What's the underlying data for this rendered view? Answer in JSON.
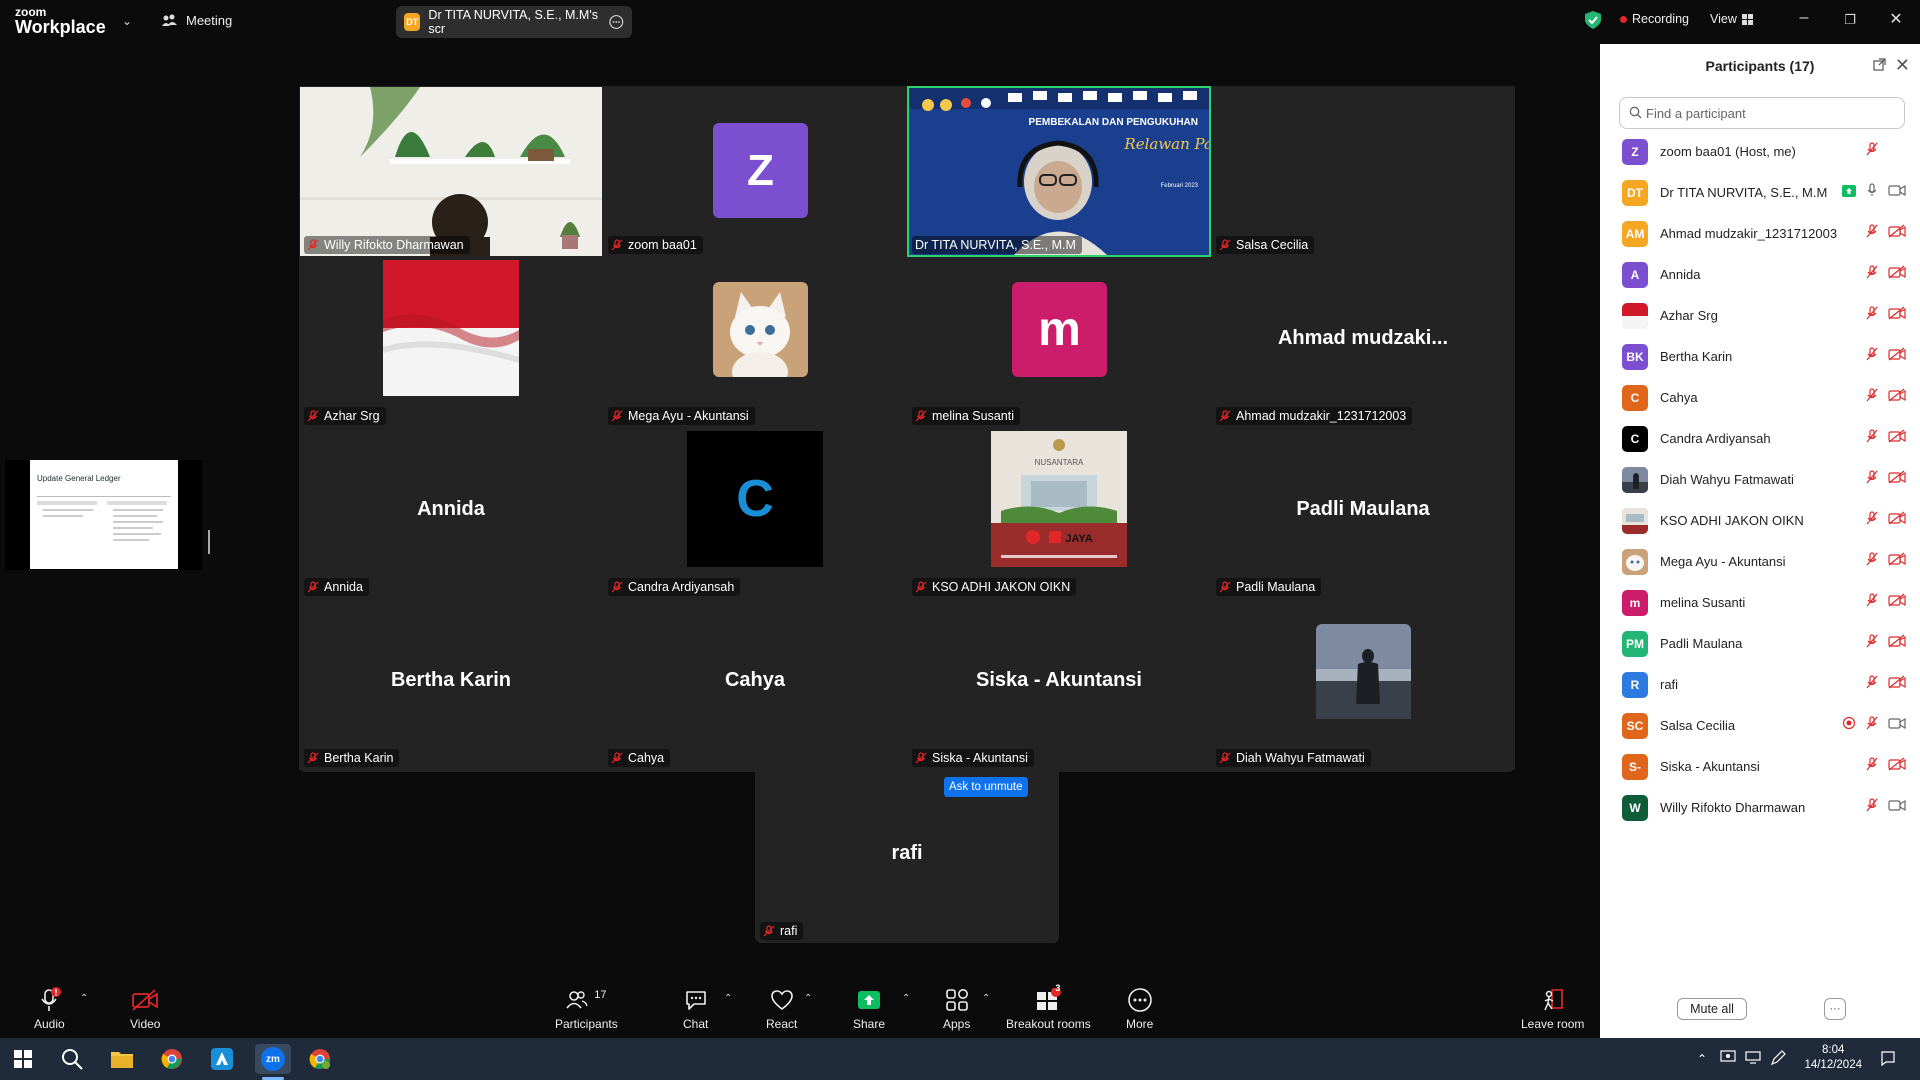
{
  "topbar": {
    "logo_small": "zoom",
    "logo_big": "Workplace",
    "meeting_label": "Meeting",
    "share_badge": "DT",
    "share_label": "Dr TITA  NURVITA, S.E., M.M's scr",
    "recording_label": "Recording",
    "view_label": "View"
  },
  "gallery": {
    "tiles": [
      {
        "name": "Willy Rifokto Dharmawan",
        "kind": "video"
      },
      {
        "name": "zoom baa01",
        "avatar_letter": "Z",
        "avatar_color": "#7b4fd0"
      },
      {
        "name": "Dr TITA  NURVITA, S.E., M.M",
        "kind": "video-active",
        "banner_line1": "PEMBEKALAN DAN PENGUKUHAN",
        "banner_line2": "Relawan Pajak",
        "banner_line3": "Februari 2023"
      },
      {
        "name": "Salsa Cecilia"
      },
      {
        "name": "Azhar Srg",
        "kind": "flag"
      },
      {
        "name": "Mega Ayu - Akuntansi",
        "kind": "cat"
      },
      {
        "name": "melina Susanti",
        "avatar_letter": "m",
        "avatar_color": "#cc1d6a"
      },
      {
        "name": "Ahmad mudzakir_1231712003",
        "big_name": "Ahmad  mudzaki..."
      },
      {
        "name": "Annida",
        "big_name": "Annida"
      },
      {
        "name": "Candra Ardiyansah",
        "avatar_letter": "C",
        "avatar_color": "#000000"
      },
      {
        "name": "KSO ADHI JAKON OIKN",
        "kind": "logo",
        "logo_top": "NUSANTARA",
        "logo_bottom": "JAYA"
      },
      {
        "name": "Padli Maulana",
        "big_name": "Padli Maulana"
      },
      {
        "name": "Bertha Karin",
        "big_name": "Bertha Karin"
      },
      {
        "name": "Cahya",
        "big_name": "Cahya"
      },
      {
        "name": "Siska - Akuntansi",
        "big_name": "Siska - Akuntansi"
      },
      {
        "name": "Diah Wahyu Fatmawati",
        "kind": "photo"
      }
    ],
    "extra_tile": {
      "name": "rafi",
      "big_name": "rafi"
    },
    "ask_to_unmute": "Ask to unmute"
  },
  "share_thumbnail": {
    "slide_title": "Update General Ledger"
  },
  "panel": {
    "title": "Participants (17)",
    "search_placeholder": "Find a participant",
    "participants": [
      {
        "name": "zoom baa01 (Host, me)",
        "initials": "Z",
        "color": "#7b4fd0",
        "mic": "muted",
        "video": "none"
      },
      {
        "name": "Dr TITA  NURVITA, S.E., M.M",
        "initials": "DT",
        "color": "#f5a623",
        "mic": "on",
        "video": "on",
        "sharing": true
      },
      {
        "name": "Ahmad mudzakir_1231712003",
        "initials": "AM",
        "color": "#f5a623",
        "mic": "muted",
        "video": "off"
      },
      {
        "name": "Annida",
        "initials": "A",
        "color": "#7b4fd0",
        "mic": "muted",
        "video": "off"
      },
      {
        "name": "Azhar Srg",
        "initials": "",
        "color": "#d9d9d9",
        "mic": "muted",
        "video": "off",
        "kind": "flag"
      },
      {
        "name": "Bertha Karin",
        "initials": "BK",
        "color": "#7b4fd0",
        "mic": "muted",
        "video": "off"
      },
      {
        "name": "Cahya",
        "initials": "C",
        "color": "#e0661b",
        "mic": "muted",
        "video": "off"
      },
      {
        "name": "Candra Ardiyansah",
        "initials": "C",
        "color": "#000000",
        "mic": "muted",
        "video": "off"
      },
      {
        "name": "Diah Wahyu Fatmawati",
        "initials": "",
        "color": "#566070",
        "mic": "muted",
        "video": "off",
        "kind": "photo"
      },
      {
        "name": "KSO ADHI JAKON OIKN",
        "initials": "",
        "color": "#8a9aa0",
        "mic": "muted",
        "video": "off",
        "kind": "logo"
      },
      {
        "name": "Mega Ayu - Akuntansi",
        "initials": "",
        "color": "#d8c9b4",
        "mic": "muted",
        "video": "off",
        "kind": "cat"
      },
      {
        "name": "melina Susanti",
        "initials": "m",
        "color": "#cc1d6a",
        "mic": "muted",
        "video": "off"
      },
      {
        "name": "Padli Maulana",
        "initials": "PM",
        "color": "#22b573",
        "mic": "muted",
        "video": "off"
      },
      {
        "name": "rafi",
        "initials": "R",
        "color": "#2d7be0",
        "mic": "muted",
        "video": "off"
      },
      {
        "name": "Salsa Cecilia",
        "initials": "SC",
        "color": "#e0661b",
        "mic": "muted",
        "video": "on",
        "recording": true
      },
      {
        "name": "Siska - Akuntansi",
        "initials": "S-",
        "color": "#e0661b",
        "mic": "muted",
        "video": "off"
      },
      {
        "name": "Willy Rifokto Dharmawan",
        "initials": "W",
        "color": "#0f5d38",
        "mic": "muted",
        "video": "on"
      }
    ],
    "mute_all": "Mute all",
    "more": "···"
  },
  "toolbar": {
    "audio": "Audio",
    "video": "Video",
    "participants": "Participants",
    "participants_count": "17",
    "chat": "Chat",
    "react": "React",
    "share": "Share",
    "apps": "Apps",
    "breakout": "Breakout rooms",
    "breakout_badge": "3",
    "more": "More",
    "leave": "Leave room"
  },
  "taskbar": {
    "time": "8:04",
    "date": "14/12/2024",
    "zoom_label": "zm"
  },
  "colors": {
    "accent_green": "#2ad36b",
    "share_green": "#0dbd62",
    "mute_red": "#e02828",
    "blue": "#0e72ed"
  }
}
